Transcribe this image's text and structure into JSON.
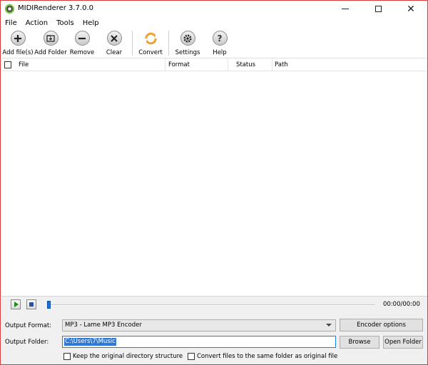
{
  "window": {
    "title": "MIDIRenderer 3.7.0.0"
  },
  "menu": {
    "items": [
      "File",
      "Action",
      "Tools",
      "Help"
    ]
  },
  "toolbar": {
    "add_files": "Add file(s)",
    "add_folder": "Add Folder",
    "remove": "Remove",
    "clear": "Clear",
    "convert": "Convert",
    "settings": "Settings",
    "help": "Help"
  },
  "list": {
    "columns": [
      "File",
      "Format",
      "Status",
      "Path"
    ],
    "rows": []
  },
  "player": {
    "time": "00:00/00:00",
    "position_fraction": 0
  },
  "settings": {
    "output_format_label": "Output Format:",
    "output_format_value": "MP3 - Lame MP3 Encoder",
    "encoder_options": "Encoder options",
    "output_folder_label": "Output Folder:",
    "output_folder_value": "C:\\Users\\7\\Music",
    "browse": "Browse",
    "open_folder": "Open Folder",
    "keep_structure": "Keep the original directory structure",
    "same_folder": "Convert files to the same folder as original file"
  },
  "colors": {
    "accent": "#1e7be0",
    "window_border": "#d83b3b",
    "convert_icon": "#f0a030"
  }
}
